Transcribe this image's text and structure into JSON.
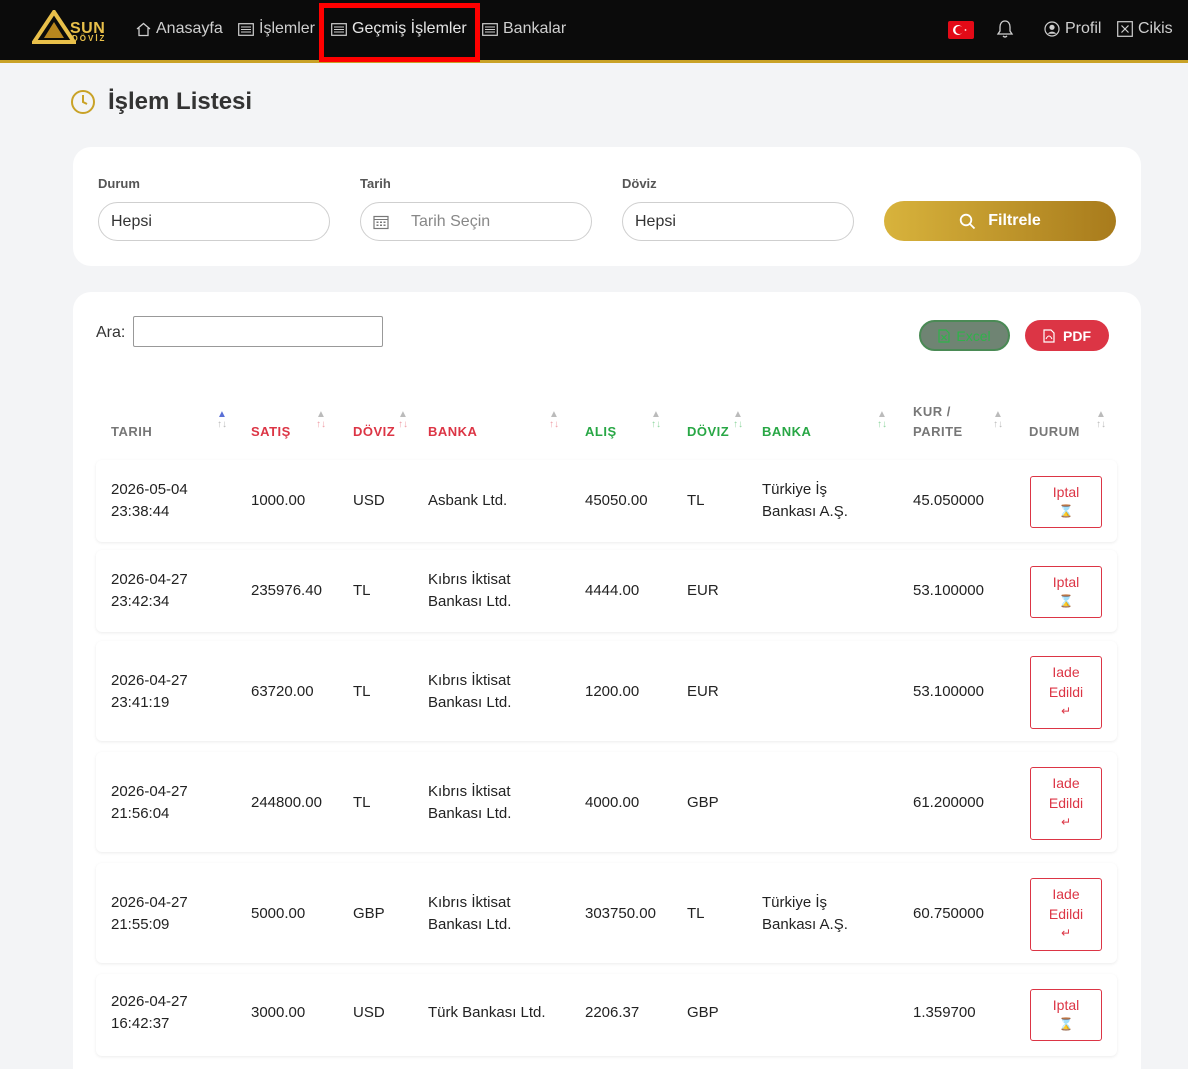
{
  "brand": {
    "name": "SUN",
    "sub": "DÖVİZ"
  },
  "nav": {
    "home": "Anasayfa",
    "transactions": "İşlemler",
    "history": "Geçmiş İşlemler",
    "banks": "Bankalar",
    "profile": "Profil",
    "logout": "Cikis"
  },
  "page": {
    "title": "İşlem Listesi"
  },
  "filters": {
    "status_label": "Durum",
    "status_value": "Hepsi",
    "date_label": "Tarih",
    "date_placeholder": "Tarih Seçin",
    "currency_label": "Döviz",
    "currency_value": "Hepsi",
    "filter_button": "Filtrele"
  },
  "table": {
    "search_label": "Ara:",
    "excel_label": "Excel",
    "pdf_label": "PDF",
    "headers": {
      "date": "TARIH",
      "sell": "SATIŞ",
      "sell_currency": "DÖVIZ",
      "sell_bank": "BANKA",
      "buy": "ALIŞ",
      "buy_currency": "DÖVIZ",
      "buy_bank": "BANKA",
      "rate_line1": "KUR /",
      "rate_line2": "PARITE",
      "status": "DURUM"
    },
    "rows": [
      {
        "date": "2026-05-04",
        "time": "23:38:44",
        "sell": "1000.00",
        "sell_currency": "USD",
        "sell_bank_1": "Asbank Ltd.",
        "sell_bank_2": "",
        "buy": "45050.00",
        "buy_currency": "TL",
        "buy_bank_1": "Türkiye İş",
        "buy_bank_2": "Bankası A.Ş.",
        "rate": "45.050000",
        "status_1": "Iptal",
        "status_2": "",
        "status_icon": "⌛"
      },
      {
        "date": "2026-04-27",
        "time": "23:42:34",
        "sell": "235976.40",
        "sell_currency": "TL",
        "sell_bank_1": "Kıbrıs İktisat",
        "sell_bank_2": "Bankası Ltd.",
        "buy": "4444.00",
        "buy_currency": "EUR",
        "buy_bank_1": "",
        "buy_bank_2": "",
        "rate": "53.100000",
        "status_1": "Iptal",
        "status_2": "",
        "status_icon": "⌛"
      },
      {
        "date": "2026-04-27",
        "time": "23:41:19",
        "sell": "63720.00",
        "sell_currency": "TL",
        "sell_bank_1": "Kıbrıs İktisat",
        "sell_bank_2": "Bankası Ltd.",
        "buy": "1200.00",
        "buy_currency": "EUR",
        "buy_bank_1": "",
        "buy_bank_2": "",
        "rate": "53.100000",
        "status_1": "Iade",
        "status_2": "Edildi",
        "status_icon": "↵"
      },
      {
        "date": "2026-04-27",
        "time": "21:56:04",
        "sell": "244800.00",
        "sell_currency": "TL",
        "sell_bank_1": "Kıbrıs İktisat",
        "sell_bank_2": "Bankası Ltd.",
        "buy": "4000.00",
        "buy_currency": "GBP",
        "buy_bank_1": "",
        "buy_bank_2": "",
        "rate": "61.200000",
        "status_1": "Iade",
        "status_2": "Edildi",
        "status_icon": "↵"
      },
      {
        "date": "2026-04-27",
        "time": "21:55:09",
        "sell": "5000.00",
        "sell_currency": "GBP",
        "sell_bank_1": "Kıbrıs İktisat",
        "sell_bank_2": "Bankası Ltd.",
        "buy": "303750.00",
        "buy_currency": "TL",
        "buy_bank_1": "Türkiye İş",
        "buy_bank_2": "Bankası A.Ş.",
        "rate": "60.750000",
        "status_1": "Iade",
        "status_2": "Edildi",
        "status_icon": "↵"
      },
      {
        "date": "2026-04-27",
        "time": "16:42:37",
        "sell": "3000.00",
        "sell_currency": "USD",
        "sell_bank_1": "Türk Bankası Ltd.",
        "sell_bank_2": "",
        "buy": "2206.37",
        "buy_currency": "GBP",
        "buy_bank_1": "",
        "buy_bank_2": "",
        "rate": "1.359700",
        "status_1": "Iptal",
        "status_2": "",
        "status_icon": "⌛"
      }
    ]
  }
}
